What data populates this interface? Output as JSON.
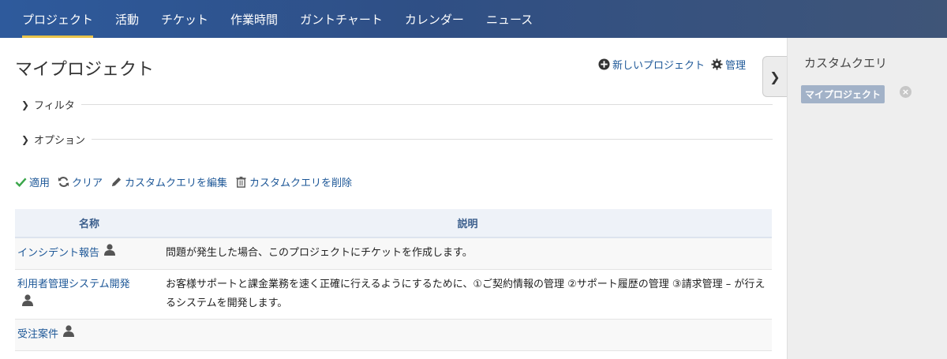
{
  "nav": {
    "items": [
      {
        "label": "プロジェクト",
        "active": true
      },
      {
        "label": "活動"
      },
      {
        "label": "チケット"
      },
      {
        "label": "作業時間"
      },
      {
        "label": "ガントチャート"
      },
      {
        "label": "カレンダー"
      },
      {
        "label": "ニュース"
      }
    ]
  },
  "main": {
    "title": "マイプロジェクト",
    "new_project_label": "新しいプロジェクト",
    "admin_label": "管理",
    "filter_label": "フィルタ",
    "options_label": "オプション",
    "actions": {
      "apply": "適用",
      "clear": "クリア",
      "edit_query": "カスタムクエリを編集",
      "delete_query": "カスタムクエリを削除"
    },
    "table": {
      "headers": {
        "name": "名称",
        "description": "説明"
      },
      "rows": [
        {
          "name": "インシデント報告",
          "description": "問題が発生した場合、このプロジェクトにチケットを作成します。"
        },
        {
          "name": "利用者管理システム開発",
          "description": "お客様サポートと課金業務を速く正確に行えるようにするために、①ご契約情報の管理 ②サポート履歴の管理 ③請求管理 – が行えるシステムを開発します。"
        },
        {
          "name": "受注案件",
          "description": ""
        }
      ]
    }
  },
  "sidebar": {
    "title": "カスタムクエリ",
    "query": "マイプロジェクト"
  },
  "colors": {
    "link": "#1d5797",
    "nav_active_underline": "#e8c34a",
    "apply_check": "#3aa64a"
  }
}
